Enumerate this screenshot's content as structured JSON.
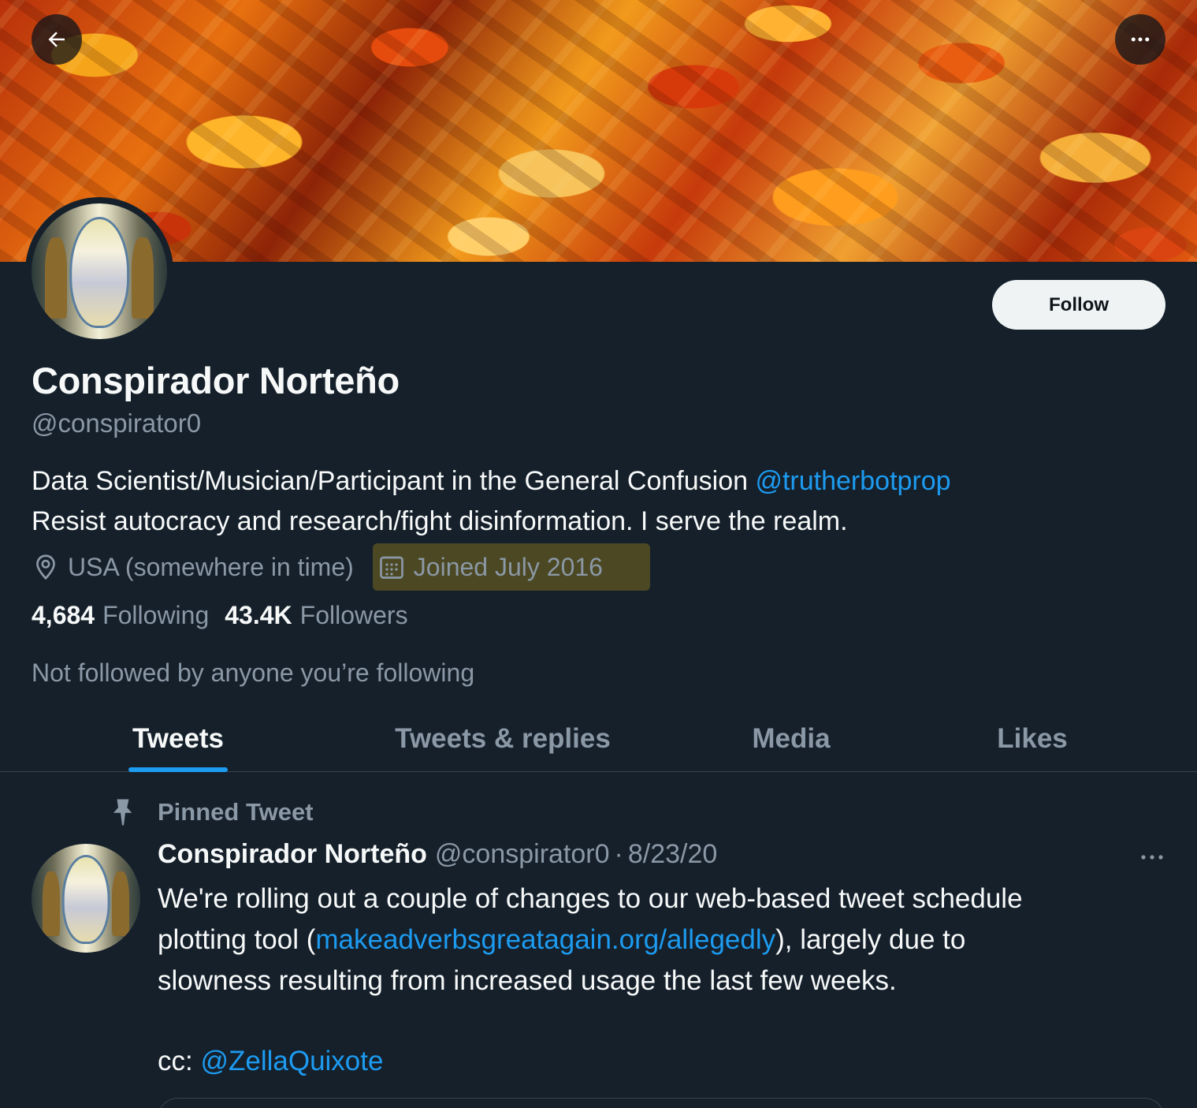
{
  "profile": {
    "name": "Conspirador Norteño",
    "handle": "@conspirator0",
    "bio_line1_text": "Data Scientist/Musician/Participant in the General Confusion ",
    "bio_line1_mention": "@trutherbotprop",
    "bio_line2": "Resist autocracy and research/fight disinformation. I serve the realm.",
    "location": "USA (somewhere in time)",
    "joined": "Joined July 2016",
    "following_count": "4,684",
    "following_label": "Following",
    "followers_count": "43.4K",
    "followers_label": "Followers",
    "not_followed": "Not followed by anyone you’re following"
  },
  "header": {
    "follow_label": "Follow",
    "back_icon": "arrow-left-icon",
    "more_icon": "more-horizontal-icon"
  },
  "tabs": [
    {
      "label": "Tweets",
      "active": true
    },
    {
      "label": "Tweets & replies",
      "active": false
    },
    {
      "label": "Media",
      "active": false
    },
    {
      "label": "Likes",
      "active": false
    }
  ],
  "pinned_tweet": {
    "pinned_label": "Pinned Tweet",
    "author_name": "Conspirador Norteño",
    "author_handle": "@conspirator0",
    "separator": "·",
    "date": "8/23/20",
    "body_line1": "We're rolling out a couple of changes to our web-based tweet schedule",
    "body_line2_pre": "plotting tool (",
    "body_line2_link": "makeadverbsgreatagain.org/allegedly",
    "body_line2_post": "), largely due to",
    "body_line3": "slowness resulting from increased usage the last few weeks.",
    "cc_label": "cc: ",
    "cc_mention": "@ZellaQuixote"
  },
  "colors": {
    "background": "#15202b",
    "accent": "#1d9bf0",
    "text_primary": "#f7f9f9",
    "text_secondary": "#8b98a5",
    "joined_highlight": "#78691e"
  }
}
